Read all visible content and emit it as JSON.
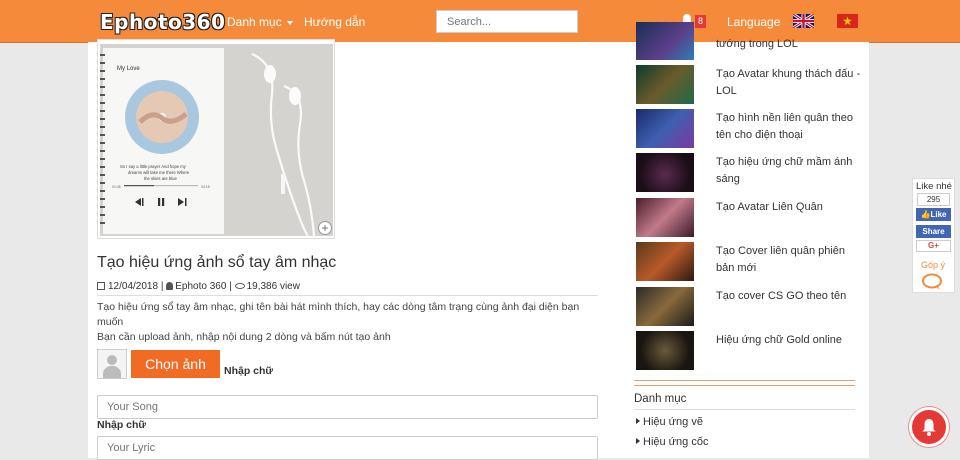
{
  "header": {
    "logo": "Ephoto360",
    "nav_category": "Danh mục",
    "nav_guide": "Hướng dẫn",
    "search_placeholder": "Search...",
    "notification_count": "8",
    "language": "Language",
    "brand_color": "#f58a3a"
  },
  "main": {
    "thumbnail": {
      "song_name": "My Love",
      "lyric": "So I say a little prayer And hope my dreams will take me there Where the skies are blue",
      "time_start": "01:35",
      "time_end": "03:15"
    },
    "title": "Tạo hiệu ứng ảnh sổ tay âm nhạc",
    "date": "12/04/2018",
    "author": "Ephoto 360",
    "views": "19,386 view",
    "description_line1": "Tạo hiệu ứng sổ tay âm nhạc, ghi tên bài hát mình thích, hay các dòng tâm trạng cùng ảnh đại diện bạn muốn",
    "description_line2": "Bạn cần upload ảnh, nhập nội dung 2 dòng và bấm nút tạo ảnh",
    "choose_image_label": "Chọn ảnh",
    "input_label_1": "Nhập chữ",
    "input_placeholder_1": "Your Song",
    "input_label_2": "Nhập chữ",
    "input_placeholder_2": "Your Lyric"
  },
  "sidebar": {
    "items": [
      {
        "label": "tướng trong LOL",
        "icon": "lol-thumbnail"
      },
      {
        "label": "Tạo Avatar khung thách đấu - LOL",
        "icon": "lol-frame-thumbnail"
      },
      {
        "label": "Tạo hình nền liên quân theo tên cho điện thoại",
        "icon": "aov-wallpaper-thumbnail"
      },
      {
        "label": "Tạo hiệu ứng chữ mầm ánh sáng",
        "icon": "light-text-thumbnail"
      },
      {
        "label": "Tạo Avatar Liên Quân",
        "icon": "aov-avatar-thumbnail"
      },
      {
        "label": "Tạo Cover liên quân phiên bản mới",
        "icon": "aov-cover-thumbnail"
      },
      {
        "label": "Tạo cover CS GO theo tên",
        "icon": "csgo-cover-thumbnail"
      },
      {
        "label": "Hiệu ứng chữ Gold online",
        "icon": "gold-text-thumbnail"
      }
    ],
    "category_title": "Danh mục",
    "categories": [
      "Hiệu ứng vẽ",
      "Hiệu ứng cốc"
    ]
  },
  "social": {
    "like_title": "Like nhé",
    "like_count": "295",
    "like_label": "Like",
    "share_label": "Share",
    "gplus_label": "G+",
    "feedback_label": "Góp ý"
  }
}
